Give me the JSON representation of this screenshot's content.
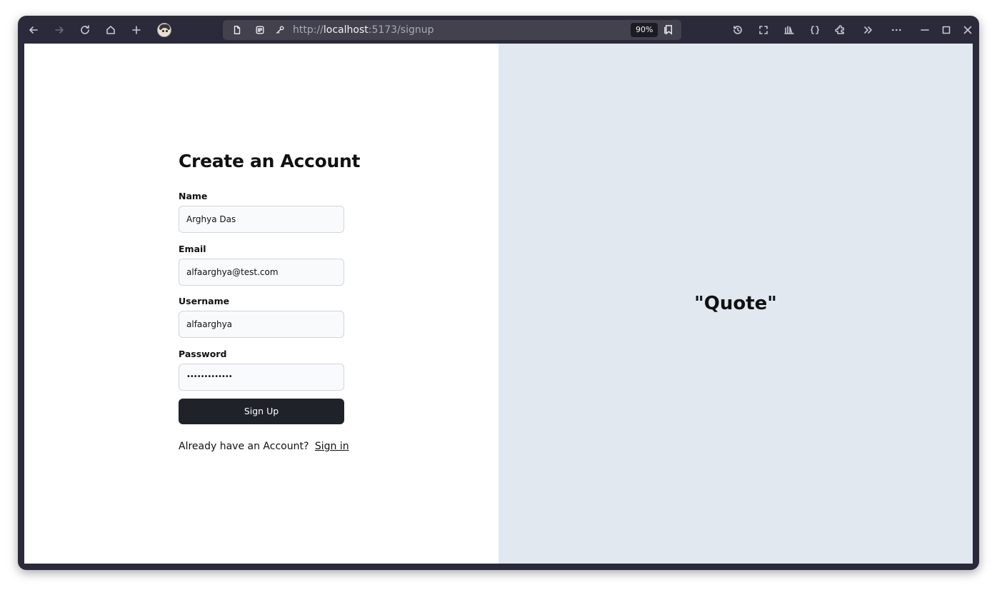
{
  "browser": {
    "url_prefix": "http://",
    "url_host": "localhost",
    "url_rest": ":5173/signup",
    "zoom": "90%",
    "icons": [
      "back-icon",
      "forward-icon",
      "reload-icon",
      "home-icon",
      "new-tab-icon",
      "profile-avatar",
      "page-icon",
      "site-info-icon",
      "permissions-icon",
      "reader-mode-icon",
      "history-icon",
      "screenshot-icon",
      "library-icon",
      "devtools-icon",
      "extensions-icon",
      "overflow-chevron-icon",
      "menu-dots-icon",
      "minimize-icon",
      "maximize-icon",
      "close-icon"
    ]
  },
  "signup_form": {
    "title": "Create an Account",
    "name_label": "Name",
    "name_value": "Arghya Das",
    "email_label": "Email",
    "email_value": "alfaarghya@test.com",
    "username_label": "Username",
    "username_value": "alfaarghya",
    "password_label": "Password",
    "password_value": "•••••••••••••",
    "submit_label": "Sign Up",
    "signin_prompt": "Already have an Account?",
    "signin_link": "Sign in"
  },
  "quote_panel": {
    "text": "\"Quote\""
  },
  "colors": {
    "window_frame": "#2b2a3a",
    "url_bar": "#42414d",
    "right_panel": "#e2e8f0",
    "button": "#1f2329"
  }
}
